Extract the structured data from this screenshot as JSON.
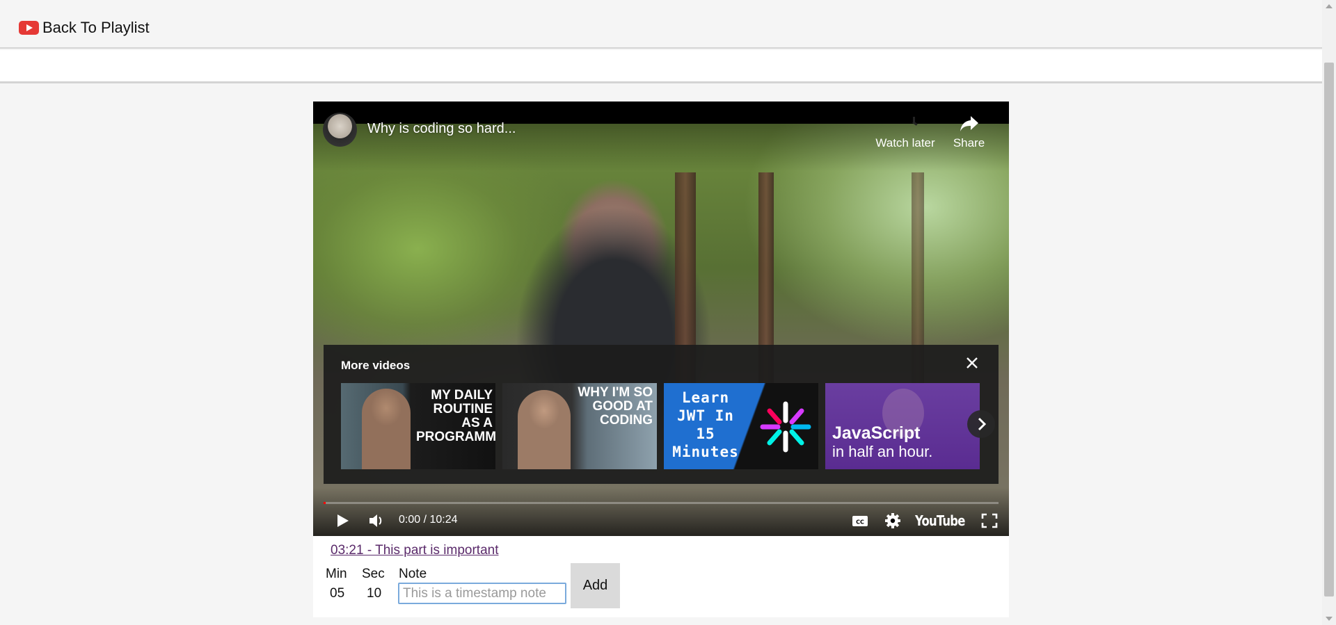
{
  "header": {
    "back_label": "Back To Playlist",
    "logo_icon": "youtube-logo-icon"
  },
  "video": {
    "title": "Why is coding so hard...",
    "watch_later_label": "Watch later",
    "share_label": "Share",
    "time_display": "0:00 / 10:24",
    "brand_label": "YouTube",
    "more_videos": {
      "heading": "More videos",
      "items": [
        {
          "title": "MY DAILY ROUTINE AS A PROGRAMMER"
        },
        {
          "title": "WHY I'M SO GOOD AT CODING"
        },
        {
          "title": "Learn JWT In 15 Minutes"
        },
        {
          "title": "JavaScript",
          "subtitle": "in half an hour."
        }
      ]
    }
  },
  "notes": {
    "saved": [
      {
        "text": "03:21 - This part is important"
      }
    ],
    "form": {
      "min_label": "Min",
      "sec_label": "Sec",
      "note_label": "Note",
      "min_value": "05",
      "sec_value": "10",
      "note_placeholder": "This is a timestamp note",
      "add_label": "Add"
    }
  },
  "colors": {
    "youtube_red": "#e53935",
    "link_visited": "#5a2a6a",
    "input_focus": "#7aaadc",
    "thumb_blue": "#1f6fd0",
    "thumb_purple": "#5a2c91"
  }
}
